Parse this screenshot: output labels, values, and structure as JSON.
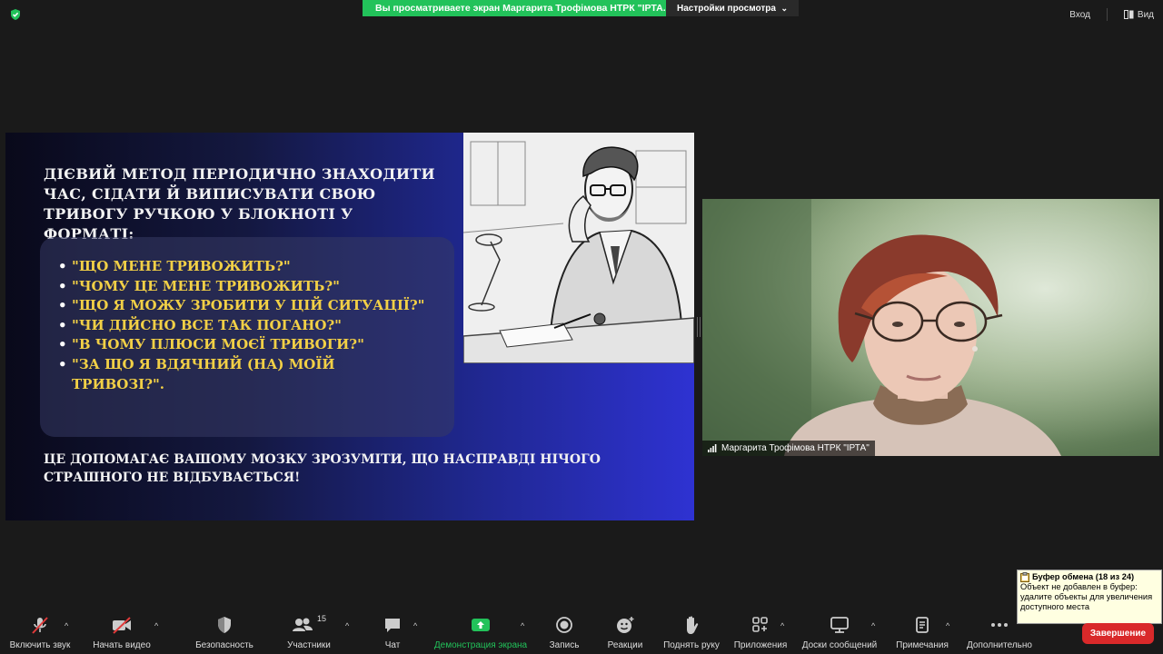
{
  "topbar": {
    "banner_text": "Вы просматриваете экран Маргарита Трофімова НТРК \"ІРТА...",
    "view_settings": "Настройки просмотра",
    "exit": "Вход",
    "view": "Вид"
  },
  "slide": {
    "heading": "ДІЄВИЙ МЕТОД ПЕРІОДИЧНО ЗНАХОДИТИ ЧАС, СІДАТИ Й ВИПИСУВАТИ СВОЮ ТРИВОГУ РУЧКОЮ У БЛОКНОТІ У ФОРМАТІ:",
    "questions": [
      "\"ЩО МЕНЕ ТРИВОЖИТЬ?\"",
      "\"ЧОМУ ЦЕ МЕНЕ ТРИВОЖИТЬ?\"",
      "\"ЩО Я МОЖУ ЗРОБИТИ У ЦІЙ СИТУАЦІЇ?\"",
      "\"ЧИ ДІЙСНО ВСЕ ТАК ПОГАНО?\"",
      "\"В ЧОМУ ПЛЮСИ МОЄЇ ТРИВОГИ?\"",
      "\"ЗА ЩО Я ВДЯЧНИЙ (НА) МОЇЙ ТРИВОЗІ?\"."
    ],
    "footer": "ЦЕ ДОПОМАГАЄ ВАШОМУ МОЗКУ ЗРОЗУМІТИ, ЩО НАСПРАВДІ НІЧОГО СТРАШНОГО НЕ ВІДБУВАЄТЬСЯ!"
  },
  "video": {
    "participant_name": "Маргарита Трофімова НТРК \"ІРТА\""
  },
  "clipboard": {
    "title": "Буфер обмена (18 из 24)",
    "message": "Объект не добавлен в буфер: удалите объекты для увеличения доступного места"
  },
  "toolbar": {
    "audio": "Включить звук",
    "video": "Начать видео",
    "security": "Безопасность",
    "participants": "Участники",
    "participants_count": "15",
    "chat": "Чат",
    "share": "Демонстрация экрана",
    "record": "Запись",
    "reactions": "Реакции",
    "raise_hand": "Поднять руку",
    "apps": "Приложения",
    "whiteboards": "Доски сообщений",
    "notes": "Примечания",
    "more": "Дополнительно",
    "end": "Завершение"
  },
  "colors": {
    "accent_green": "#22c25a",
    "end_red": "#d9292a",
    "question_yellow": "#f2d046"
  }
}
